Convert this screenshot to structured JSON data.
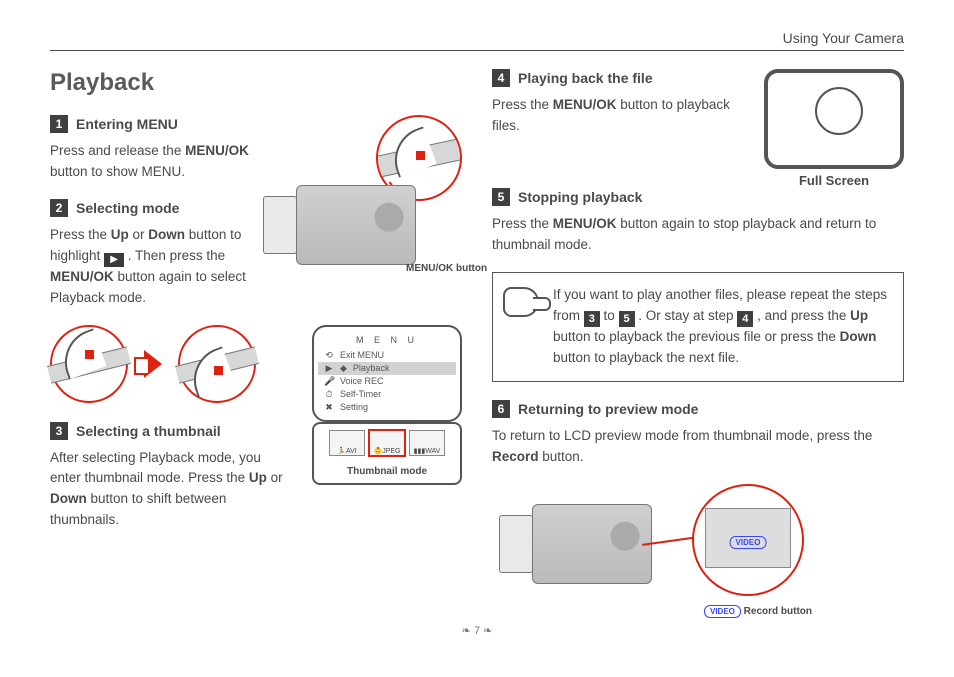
{
  "header": {
    "section": "Using Your Camera"
  },
  "title": "Playback",
  "steps": {
    "s1": {
      "n": "1",
      "title": "Entering MENU",
      "text_a": "Press and release the ",
      "bold_a": "MENU/OK",
      "text_b": " button to show MENU."
    },
    "s2": {
      "n": "2",
      "title": "Selecting mode",
      "text_a": "Press the ",
      "bold_up": "Up",
      "text_or": " or ",
      "bold_down": "Down",
      "text_b": " button to highlight ",
      "text_c": " . Then press the ",
      "bold_menuok": "MENU/OK",
      "text_d": " button again to select Playback mode."
    },
    "s3": {
      "n": "3",
      "title": "Selecting a thumbnail",
      "text_a": "After selecting Playback mode, you enter thumbnail mode. Press the ",
      "bold_up": "Up",
      "text_or": " or ",
      "bold_down": "Down",
      "text_b": " button to shift between thumbnails."
    },
    "s4": {
      "n": "4",
      "title": "Playing back the file",
      "text_a": "Press the ",
      "bold_a": "MENU/OK",
      "text_b": " button to playback files."
    },
    "s5": {
      "n": "5",
      "title": "Stopping playback",
      "text_a": "Press the ",
      "bold_a": "MENU/OK",
      "text_b": " button again to stop playback and return to thumbnail mode."
    },
    "s6": {
      "n": "6",
      "title": "Returning to preview mode",
      "text_a": "To return to LCD preview mode from thumbnail mode, press the ",
      "bold_a": "Record",
      "text_b": " button."
    }
  },
  "note": {
    "a": "If you want to play another files, please repeat the steps from ",
    "n3": "3",
    "to": " to ",
    "n5": "5",
    "b": " . Or stay at step ",
    "n4": "4",
    "c": " , and press the ",
    "up": "Up",
    "d": " button to playback the previous file or press the ",
    "down": "Down",
    "e": " button to playback the next file."
  },
  "labels": {
    "menuok_button": "MENU/OK button",
    "thumbnail_mode": "Thumbnail mode",
    "full_screen": "Full Screen",
    "record_button": "Record button",
    "video_pill": "VIDEO"
  },
  "menu": {
    "title": "M E N U",
    "items": [
      "Exit MENU",
      "Playback",
      "Voice REC",
      "Self-Timer",
      "Setting"
    ],
    "icons": [
      "⟲",
      "▶",
      "🎤",
      "⏱",
      "✖"
    ]
  },
  "thumbnails": {
    "cells": [
      "AVI",
      "JPEG",
      "WAV"
    ],
    "selected": 1
  },
  "page_number": "7"
}
